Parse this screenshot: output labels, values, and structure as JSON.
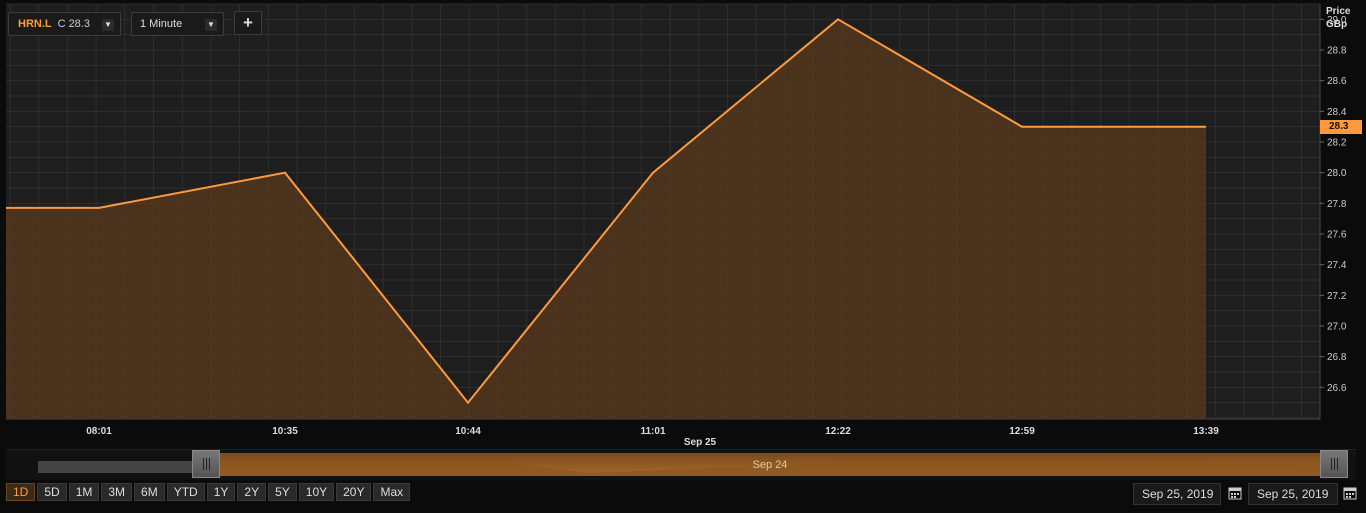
{
  "toolbar": {
    "symbol": "HRN.L",
    "close_label": "C",
    "close_value": "28.3",
    "interval": "1 Minute",
    "add_label": "+"
  },
  "axis": {
    "title_line1": "Price",
    "title_line2": "GBp"
  },
  "last_price_tag": "28.3",
  "navigator": {
    "label": "Sep 24"
  },
  "range_buttons": [
    "1D",
    "5D",
    "1M",
    "3M",
    "6M",
    "YTD",
    "1Y",
    "2Y",
    "5Y",
    "10Y",
    "20Y",
    "Max"
  ],
  "active_range": "1D",
  "dates": {
    "from": "Sep 25, 2019",
    "to": "Sep 25, 2019"
  },
  "colors": {
    "line": "#ff9a3c",
    "fill": "#5a3a1e",
    "grid": "#303030",
    "background": "#1e1e1e"
  },
  "chart_data": {
    "type": "area",
    "x": [
      "start",
      "08:01",
      "10:35",
      "10:44",
      "11:01",
      "12:22",
      "12:59",
      "13:39"
    ],
    "x_ticks": [
      "08:01",
      "10:35",
      "10:44",
      "11:01",
      "12:22",
      "12:59",
      "13:39"
    ],
    "date_label": {
      "text": "Sep 25",
      "under": "11:01"
    },
    "values": [
      27.77,
      27.77,
      28.0,
      26.5,
      28.0,
      29.0,
      28.3,
      28.3
    ],
    "y_ticks": [
      26.6,
      26.8,
      27.0,
      27.2,
      27.4,
      27.6,
      27.8,
      28.0,
      28.2,
      28.4,
      28.6,
      28.8,
      29.0
    ],
    "ylim": [
      26.4,
      29.1
    ],
    "grid": true,
    "last_value": 28.3
  }
}
